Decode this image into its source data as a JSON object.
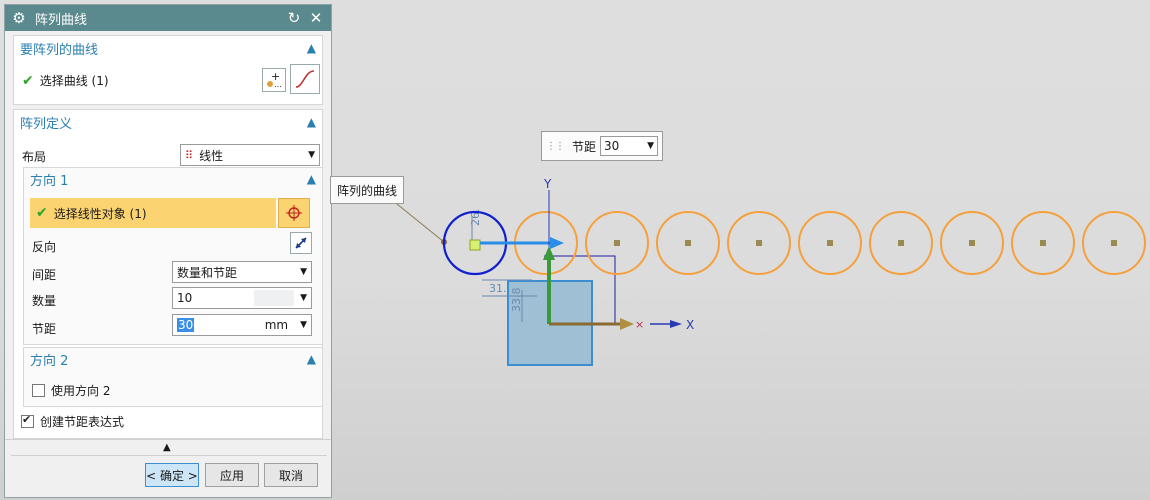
{
  "dialog": {
    "title": "阵列曲线",
    "icons": {
      "settings": "gear-icon",
      "reset": "reset-icon",
      "close": "close-icon"
    }
  },
  "curves_section": {
    "header": "要阵列的曲线",
    "select_label": "选择曲线 (1)"
  },
  "definition_section": {
    "header": "阵列定义",
    "layout_label": "布局",
    "layout_value": "线性",
    "direction1": {
      "header": "方向 1",
      "select_linear": "选择线性对象 (1)",
      "reverse_label": "反向",
      "spacing_label": "间距",
      "spacing_value": "数量和节距",
      "count_label": "数量",
      "count_value": "10",
      "pitch_label": "节距",
      "pitch_value": "30",
      "pitch_unit": "mm"
    },
    "direction2": {
      "header": "方向 2",
      "use_label": "使用方向 2",
      "use_checked": false
    },
    "create_expr_label": "创建节距表达式",
    "create_expr_checked": true
  },
  "buttons": {
    "ok": "< 确定 >",
    "apply": "应用",
    "cancel": "取消"
  },
  "viewport": {
    "pitch_popup_label": "节距",
    "pitch_popup_value": "30",
    "curve_tooltip": "阵列的曲线",
    "dim_26": "26.",
    "dim_31": "31.",
    "dim_33": "33.8",
    "axis_x": "X",
    "axis_y": "Y",
    "colors": {
      "accent": "#2a7fb0",
      "titlebar": "#5a8a8e",
      "selected_row": "#fcd371",
      "circle_orange": "#f5a03c",
      "circle_blue": "#1020d0"
    }
  }
}
